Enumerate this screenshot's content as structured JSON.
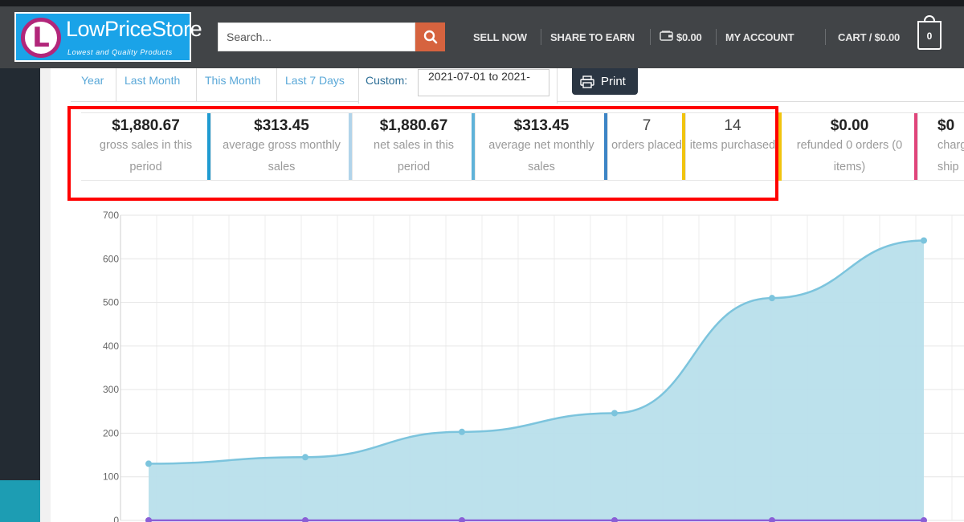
{
  "header": {
    "logo": {
      "name": "LowPriceStore",
      "tagline": "Lowest and Quality Products"
    },
    "search": {
      "placeholder": "Search...",
      "value": ""
    },
    "nav": {
      "sell_now": "SELL NOW",
      "share_to_earn": "SHARE TO EARN",
      "wallet": "$0.00",
      "my_account": "MY ACCOUNT",
      "cart": "CART / $0.00",
      "cart_count": "0"
    }
  },
  "range_tabs": [
    "Year",
    "Last Month",
    "This Month",
    "Last 7 Days"
  ],
  "custom": {
    "label": "Custom:",
    "date_range": "2021-07-01 to 2021-"
  },
  "print_label": "Print",
  "stats": [
    {
      "value": "$1,880.67",
      "label": "gross sales in this period",
      "color": "#1f9bd1"
    },
    {
      "value": "$313.45",
      "label": "average gross monthly sales",
      "color": "#b1d4ea"
    },
    {
      "value": "$1,880.67",
      "label": "net sales in this period",
      "color": "#5fb2d8"
    },
    {
      "value": "$313.45",
      "label": "average net monthly sales",
      "color": "#3d85c6"
    },
    {
      "value": "7",
      "label": "orders placed",
      "color": "#f1c40f"
    },
    {
      "value": "14",
      "label": "items purchased",
      "color": "#e0e0e0"
    },
    {
      "value": "$0.00",
      "label": "refunded 0 orders (0 items)",
      "color": "#e0457b"
    },
    {
      "value": "$0",
      "label": "charg ship",
      "color": "#e0e0e0"
    }
  ],
  "colors": {
    "header_bg": "#414447",
    "search_button": "#d6633f",
    "highlight": "#ff0000",
    "area_fill": "#b8dfeb",
    "area_line": "#7cc4dd",
    "baseline": "#8a5fd6"
  },
  "chart_data": {
    "type": "area",
    "title": "",
    "xlabel": "",
    "ylabel": "",
    "ylim": [
      0,
      700
    ],
    "yticks": [
      "0",
      "100",
      "200",
      "300",
      "400",
      "500",
      "600",
      "700"
    ],
    "grid": true,
    "series": [
      {
        "values": [
          130,
          145,
          203,
          246,
          510,
          642
        ]
      },
      {
        "values": [
          0,
          0,
          0,
          0,
          0,
          0
        ]
      }
    ]
  }
}
